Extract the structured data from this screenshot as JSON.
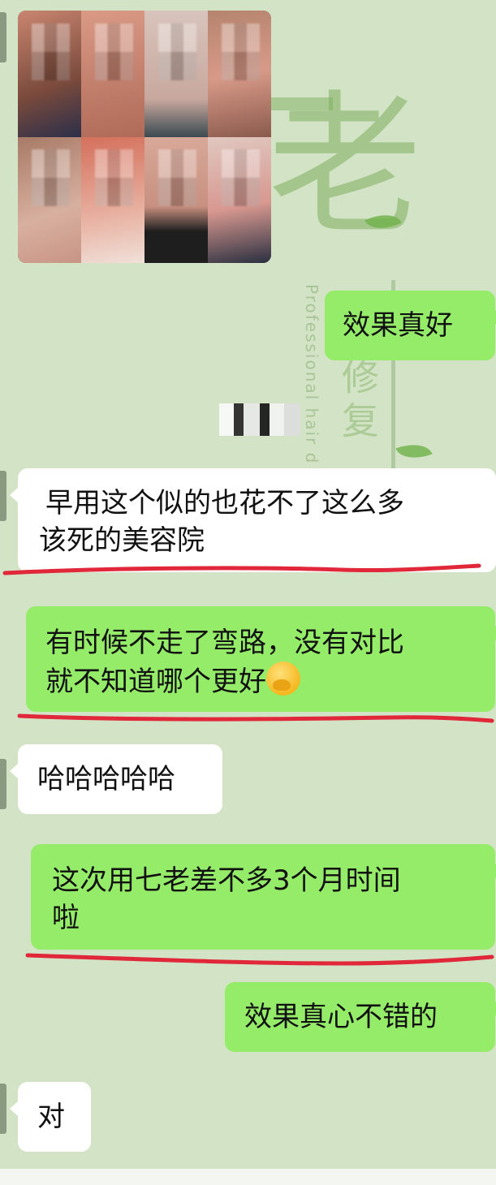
{
  "background": {
    "watermark_big_char": "老",
    "watermark_vertical_en": "Professional hair d",
    "watermark_vertical_cn": "修复"
  },
  "chat": {
    "messages": [
      {
        "side": "left",
        "text": "早用这个似的也花不了这么多该死的美容院",
        "underlined": true
      },
      {
        "side": "right",
        "text": "有时候不走了弯路，没有对比就不知道哪个更好",
        "emoji": "face-with-hand-over-mouth",
        "underlined": true
      },
      {
        "side": "left",
        "text": "哈哈哈哈哈"
      },
      {
        "side": "right",
        "text": "这次用七老差不多3个月时间啦",
        "underlined": true
      },
      {
        "side": "right",
        "text": "效果真心不错的"
      },
      {
        "side": "left",
        "text": "对"
      }
    ],
    "first_reply": "效果真好",
    "line1a": "早用这个似的也花不了这么多",
    "line1b": "该死的美容院",
    "line2a": "有时候不走了弯路，没有对比",
    "line2b": "就不知道哪个更好",
    "line3": "哈哈哈哈哈",
    "line4a": "这次用七老差不多3个月时间",
    "line4b": "啦",
    "line5": "效果真心不错的",
    "line6": "对"
  },
  "colors": {
    "chat_bg": "#d2e3c6",
    "bubble_self": "#95ec69",
    "bubble_other": "#ffffff",
    "underline": "#e0283a"
  },
  "image_message": {
    "grid_columns": 4,
    "grid_rows": 2,
    "content": "blurred face photos"
  }
}
